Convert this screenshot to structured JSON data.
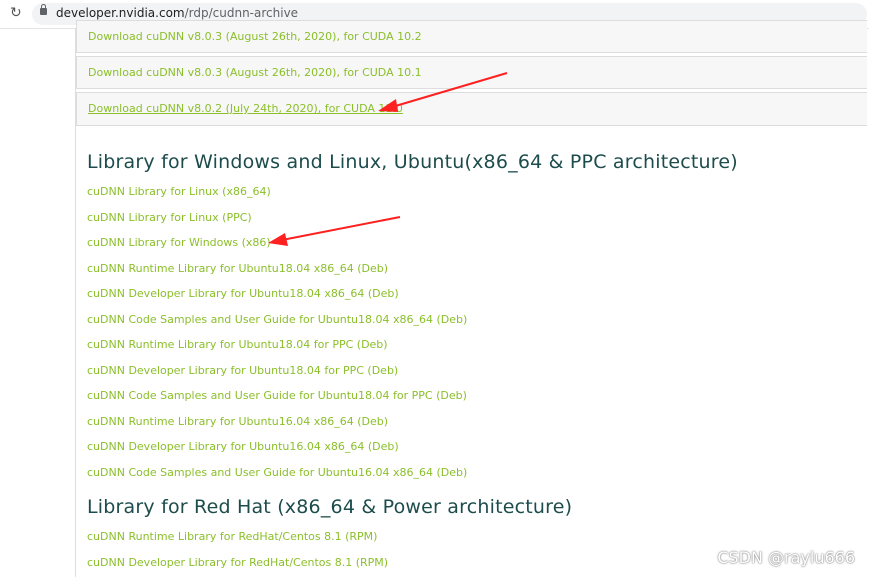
{
  "browser": {
    "url_host": "developer.nvidia.com",
    "url_path": "/rdp/cudnn-archive"
  },
  "download_boxes": [
    {
      "label": "Download cuDNN v8.0.3 (August 26th, 2020), for CUDA 10.2"
    },
    {
      "label": "Download cuDNN v8.0.3 (August 26th, 2020), for CUDA 10.1"
    },
    {
      "label": "Download cuDNN v8.0.2 (July 24th, 2020), for CUDA 11.0"
    }
  ],
  "section1": {
    "title": "Library for Windows and Linux, Ubuntu(x86_64 & PPC architecture)",
    "links": [
      "cuDNN Library for Linux (x86_64)",
      "cuDNN Library for Linux (PPC)",
      "cuDNN Library for Windows (x86)",
      "cuDNN Runtime Library for Ubuntu18.04 x86_64 (Deb)",
      "cuDNN Developer Library for Ubuntu18.04 x86_64 (Deb)",
      "cuDNN Code Samples and User Guide for Ubuntu18.04 x86_64 (Deb)",
      "cuDNN Runtime Library for Ubuntu18.04 for PPC (Deb)",
      "cuDNN Developer Library for Ubuntu18.04 for PPC (Deb)",
      "cuDNN Code Samples and User Guide for Ubuntu18.04 for PPC (Deb)",
      "cuDNN Runtime Library for Ubuntu16.04 x86_64 (Deb)",
      "cuDNN Developer Library for Ubuntu16.04 x86_64 (Deb)",
      "cuDNN Code Samples and User Guide for Ubuntu16.04 x86_64 (Deb)"
    ]
  },
  "section2": {
    "title": "Library for Red Hat (x86_64 & Power architecture)",
    "links": [
      "cuDNN Runtime Library for RedHat/Centos 8.1 (RPM)",
      "cuDNN Developer Library for RedHat/Centos 8.1 (RPM)"
    ]
  },
  "watermark": "CSDN @raylu666",
  "colors": {
    "link": "#8bbf2a",
    "heading": "#1d4c4c",
    "annotation": "#ff2020"
  }
}
